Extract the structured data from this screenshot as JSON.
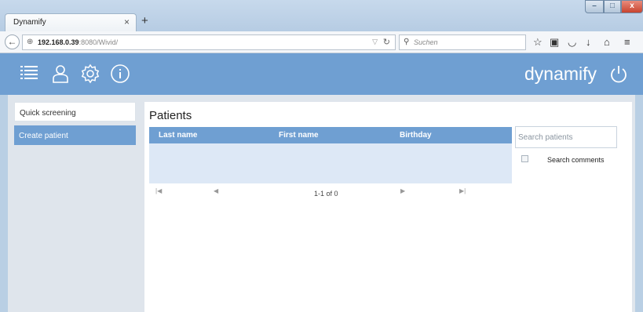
{
  "browser": {
    "tab_title": "Dynamify",
    "tab_close": "×",
    "new_tab": "+",
    "url_host": "192.168.0.39",
    "url_rest": ":8080/Wivid/",
    "search_placeholder": "Suchen",
    "window_controls": [
      "–",
      "□",
      "x"
    ]
  },
  "app": {
    "brand": "dynamify",
    "header_icons": [
      "list-icon",
      "user-icon",
      "settings-icon",
      "info-icon"
    ],
    "accent_color": "#6f9fd2"
  },
  "sidebar": {
    "items": [
      {
        "label": "Quick screening"
      },
      {
        "label": "Create patient"
      }
    ]
  },
  "main": {
    "title": "Patients",
    "columns": [
      "Last name",
      "First name",
      "Birthday"
    ],
    "rows": [],
    "pager": {
      "info": "1-1 of 0"
    },
    "search": {
      "placeholder": "Search patients"
    },
    "search_comments_label": "Search comments"
  }
}
